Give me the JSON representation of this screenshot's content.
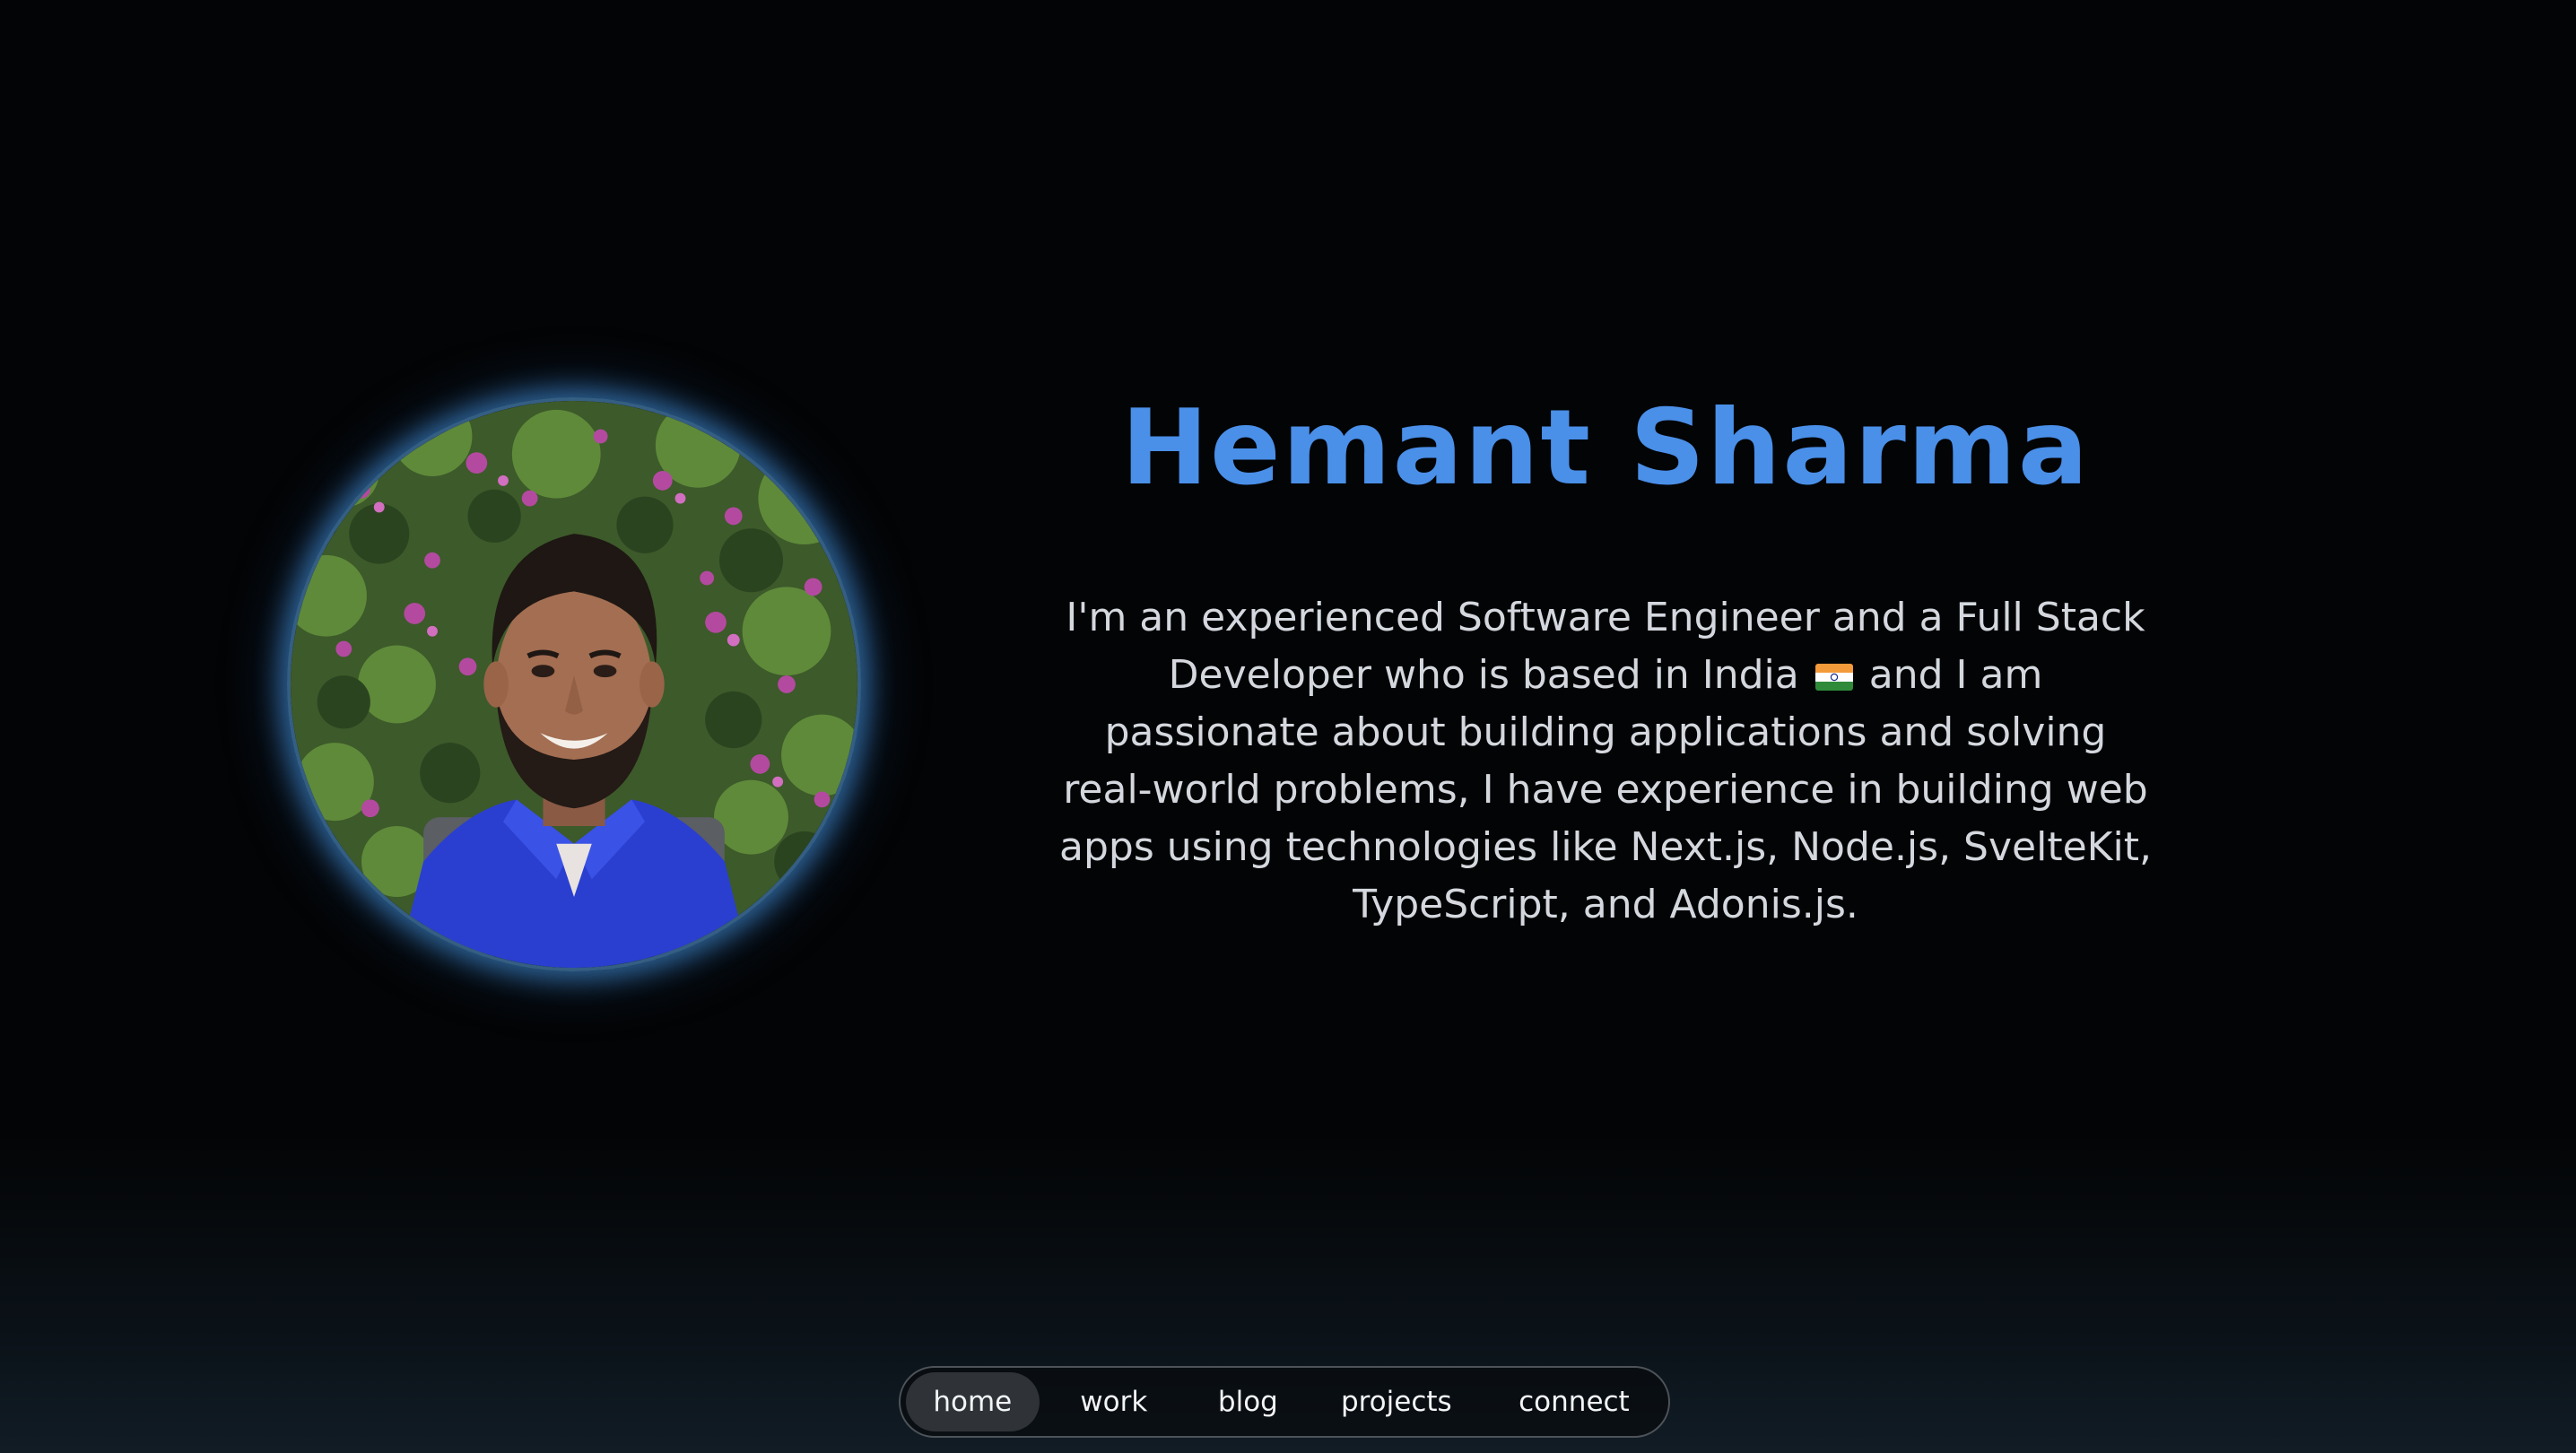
{
  "profile": {
    "name": "Hemant Sharma",
    "bio_before_flag": "I'm an experienced Software Engineer and a Full Stack Developer who is based in India",
    "flag_icon": "india-flag-icon",
    "bio_after_flag": "and I am passionate about building applications and solving real-world problems, I have experience in building web apps using technologies like Next.js, Node.js, SvelteKit, TypeScript, and Adonis.js.",
    "accent_color": "#4a8fe8"
  },
  "nav": {
    "items": [
      {
        "label": "home",
        "active": true
      },
      {
        "label": "work",
        "active": false
      },
      {
        "label": "blog",
        "active": false
      },
      {
        "label": "projects",
        "active": false
      },
      {
        "label": "connect",
        "active": false
      }
    ]
  }
}
